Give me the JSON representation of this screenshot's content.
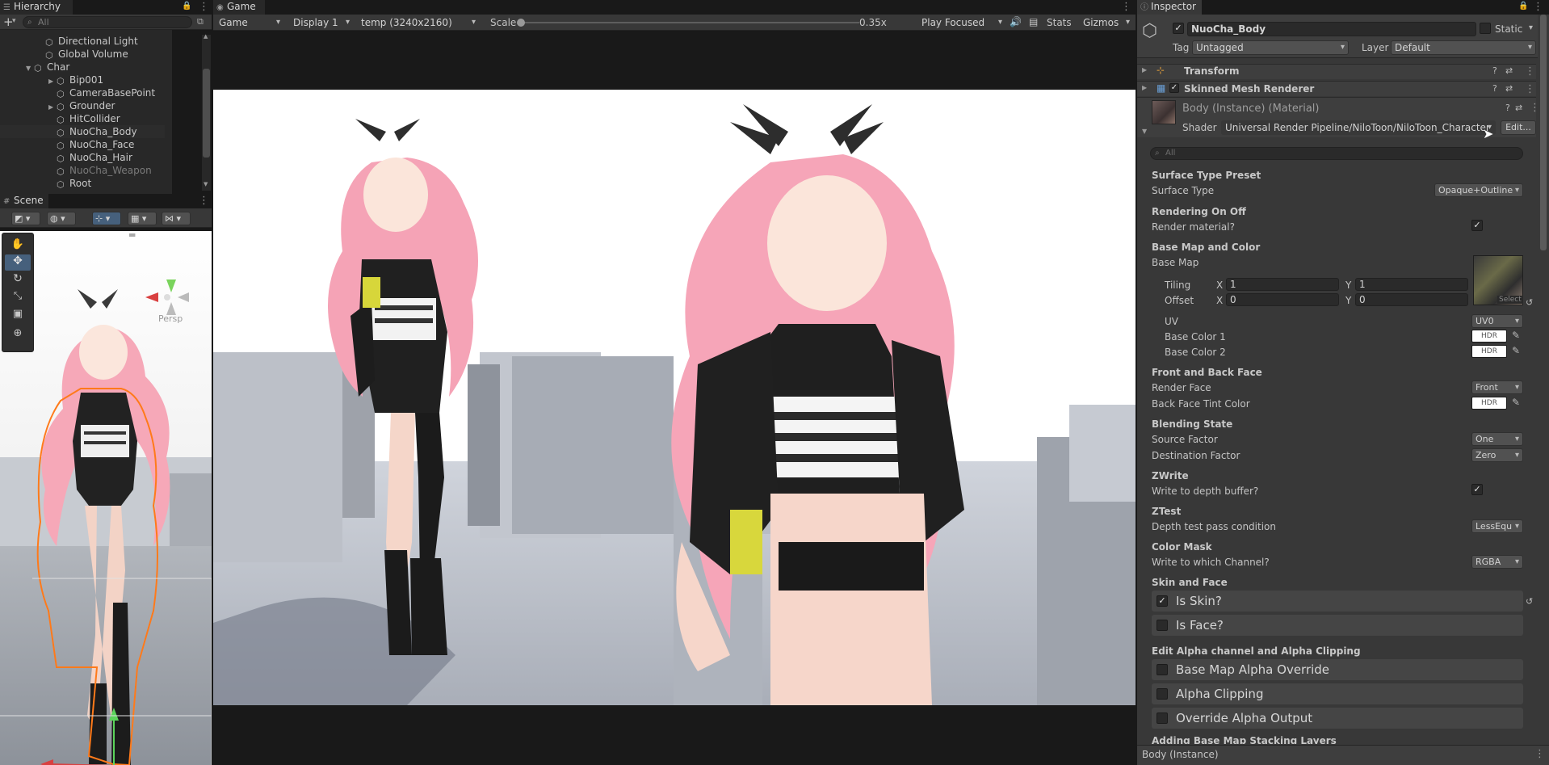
{
  "hierarchy": {
    "tab": "Hierarchy",
    "search_placeholder": "All",
    "items": [
      {
        "label": "Directional Light",
        "indent": 1
      },
      {
        "label": "Global Volume",
        "indent": 1
      },
      {
        "label": "Char",
        "indent": 0
      },
      {
        "label": "Bip001",
        "indent": 2
      },
      {
        "label": "CameraBasePoint",
        "indent": 2
      },
      {
        "label": "Grounder",
        "indent": 2
      },
      {
        "label": "HitCollider",
        "indent": 2
      },
      {
        "label": "NuoCha_Body",
        "indent": 2
      },
      {
        "label": "NuoCha_Face",
        "indent": 2
      },
      {
        "label": "NuoCha_Hair",
        "indent": 2
      },
      {
        "label": "NuoCha_Weapon",
        "indent": 2
      },
      {
        "label": "Root",
        "indent": 2
      }
    ]
  },
  "scene": {
    "tab": "Scene",
    "persp_label": "Persp"
  },
  "game": {
    "tab": "Game",
    "mode_dropdown": "Game",
    "display_dropdown": "Display 1",
    "resolution_dropdown": "temp (3240x2160)",
    "scale_label": "Scale",
    "scale_value": "0.35x",
    "play_focused": "Play Focused",
    "stats": "Stats",
    "gizmos": "Gizmos"
  },
  "inspector": {
    "tab": "Inspector",
    "object_name": "NuoCha_Body",
    "static_label": "Static",
    "tag_label": "Tag",
    "tag_value": "Untagged",
    "layer_label": "Layer",
    "layer_value": "Default",
    "components": {
      "transform": "Transform",
      "skinned_mesh": "Skinned Mesh Renderer"
    },
    "material": {
      "name": "Body (Instance) (Material)",
      "shader_label": "Shader",
      "shader_value": "Universal Render Pipeline/NiloToon/NiloToon_Character",
      "edit_button": "Edit..."
    },
    "search_placeholder": "All",
    "props": {
      "surface_type_preset": "Surface Type Preset",
      "surface_type": "Surface Type",
      "surface_type_value": "Opaque+Outline",
      "rendering_on_off": "Rendering On Off",
      "render_material": "Render material?",
      "base_map_and_color": "Base Map and Color",
      "base_map": "Base Map",
      "select": "Select",
      "tiling": "Tiling",
      "tiling_x": "1",
      "tiling_y": "1",
      "offset": "Offset",
      "offset_x": "0",
      "offset_y": "0",
      "x": "X",
      "y": "Y",
      "uv": "UV",
      "uv_value": "UV0",
      "base_color_1": "Base Color 1",
      "base_color_2": "Base Color 2",
      "hdr": "HDR",
      "front_back_face": "Front and Back Face",
      "render_face": "Render Face",
      "render_face_value": "Front",
      "back_face_tint": "Back Face Tint Color",
      "blending_state": "Blending State",
      "source_factor": "Source Factor",
      "source_factor_value": "One",
      "dest_factor": "Destination Factor",
      "dest_factor_value": "Zero",
      "zwrite": "ZWrite",
      "write_depth": "Write to depth buffer?",
      "ztest": "ZTest",
      "depth_test": "Depth test pass condition",
      "depth_test_value": "LessEqu",
      "color_mask": "Color Mask",
      "write_channel": "Write to which Channel?",
      "write_channel_value": "RGBA",
      "skin_and_face": "Skin and Face",
      "is_skin": "Is Skin?",
      "is_face": "Is Face?",
      "edit_alpha": "Edit Alpha channel and Alpha Clipping",
      "base_map_alpha_override": "Base Map Alpha Override",
      "alpha_clipping": "Alpha Clipping",
      "override_alpha_output": "Override Alpha Output",
      "adding_layers": "Adding Base Map Stacking Layers"
    },
    "footer": "Body (Instance)"
  }
}
